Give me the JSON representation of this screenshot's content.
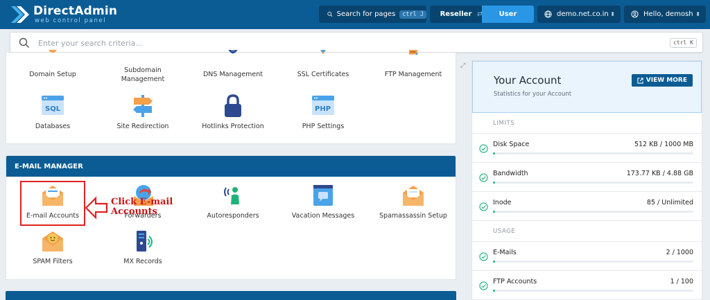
{
  "app": {
    "name": "DirectAdmin",
    "tagline": "web control panel"
  },
  "topbar": {
    "search_label": "Search for pages",
    "search_shortcut": "ctrl J",
    "role_reseller": "Reseller",
    "role_user": "User",
    "domain": "demo.net.co.in",
    "greeting": "Hello, demosh"
  },
  "search": {
    "placeholder": "Enter your search criteria...",
    "shortcut": "ctrl K"
  },
  "top_section": {
    "items": [
      {
        "label": "Domain Setup",
        "icon": "globe-icon"
      },
      {
        "label": "Subdomain Management",
        "icon": "subdomain-icon"
      },
      {
        "label": "DNS Management",
        "icon": "dns-globe-icon"
      },
      {
        "label": "SSL Certificates",
        "icon": "ribbon-icon"
      },
      {
        "label": "FTP Management",
        "icon": "ftp-folder-icon"
      },
      {
        "label": "Databases",
        "icon": "sql-icon",
        "icon_text": "SQL"
      },
      {
        "label": "Site Redirection",
        "icon": "signpost-icon"
      },
      {
        "label": "Hotlinks Protection",
        "icon": "lock-icon"
      },
      {
        "label": "PHP Settings",
        "icon": "php-icon",
        "icon_text": "PHP"
      }
    ]
  },
  "email_manager": {
    "title": "E-MAIL MANAGER",
    "items": [
      {
        "label": "E-mail Accounts",
        "icon": "envelope-icon"
      },
      {
        "label": "Forwarders",
        "icon": "forward-mail-icon"
      },
      {
        "label": "Autoresponders",
        "icon": "autoresponder-icon"
      },
      {
        "label": "Vacation Messages",
        "icon": "vacation-screen-icon"
      },
      {
        "label": "Spamassassin Setup",
        "icon": "spam-envelope-icon"
      },
      {
        "label": "SPAM Filters",
        "icon": "spam-filter-icon"
      },
      {
        "label": "MX Records",
        "icon": "mx-server-icon"
      }
    ],
    "callout": "Click E-mail Accounts"
  },
  "account": {
    "title": "Your Account",
    "subtitle": "Statistics for your Account",
    "view_more": "VIEW MORE",
    "limits_label": "LIMITS",
    "usage_label": "USAGE",
    "limits": [
      {
        "name": "Disk Space",
        "value": "512 KB / 1000 MB",
        "fill": 0.01
      },
      {
        "name": "Bandwidth",
        "value": "173.77 KB / 4.88 GB",
        "fill": 0.01
      },
      {
        "name": "Inode",
        "value": "85 / Unlimited",
        "fill": 0.01
      }
    ],
    "usage": [
      {
        "name": "E-Mails",
        "value": "2 / 1000",
        "fill": 0.01
      },
      {
        "name": "FTP Accounts",
        "value": "1 / 100",
        "fill": 0.01
      }
    ]
  },
  "colors": {
    "brand": "#0b5c94",
    "accent": "#2a96e6",
    "tile_orange": "#f5a04a",
    "tile_blue": "#4aa3e8",
    "callout_red": "#e02020",
    "success": "#1fb37a"
  }
}
